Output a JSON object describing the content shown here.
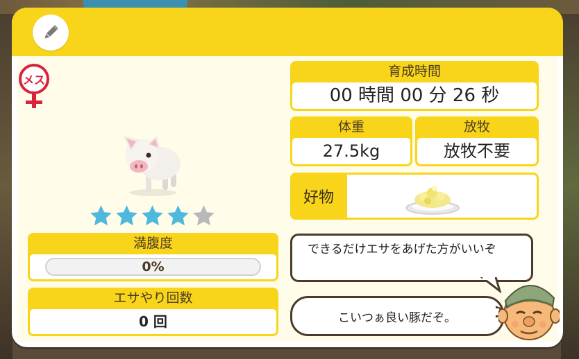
{
  "header": {
    "edit_icon": "pencil-icon"
  },
  "gender": {
    "icon": "female-symbol-icon",
    "label": "メス"
  },
  "pig": {
    "icon": "piglet-icon"
  },
  "rating": {
    "value": 4,
    "max": 5,
    "filled_color": "#4fb8dd",
    "empty_color": "#b8b8b8"
  },
  "hunger": {
    "label": "満腹度",
    "value": 0,
    "value_text": "0%"
  },
  "feed_count": {
    "label": "エサやり回数",
    "value": "0 回"
  },
  "growth_time": {
    "label": "育成時間",
    "value": "00 時間 00 分 26 秒"
  },
  "weight": {
    "label": "体重",
    "value": "27.5kg"
  },
  "grazing": {
    "label": "放牧",
    "value": "放牧不要"
  },
  "favorite": {
    "label": "好物",
    "icon": "feed-plate-icon"
  },
  "speech": {
    "line1": "できるだけエサをあげた方がいいぞ",
    "line2": "こいつぁ良い豚だぞ。"
  },
  "npc": {
    "icon": "farmer-face-icon"
  },
  "colors": {
    "accent": "#f8d51a",
    "panel_bg": "#fffcea",
    "star": "#4fb8dd"
  }
}
